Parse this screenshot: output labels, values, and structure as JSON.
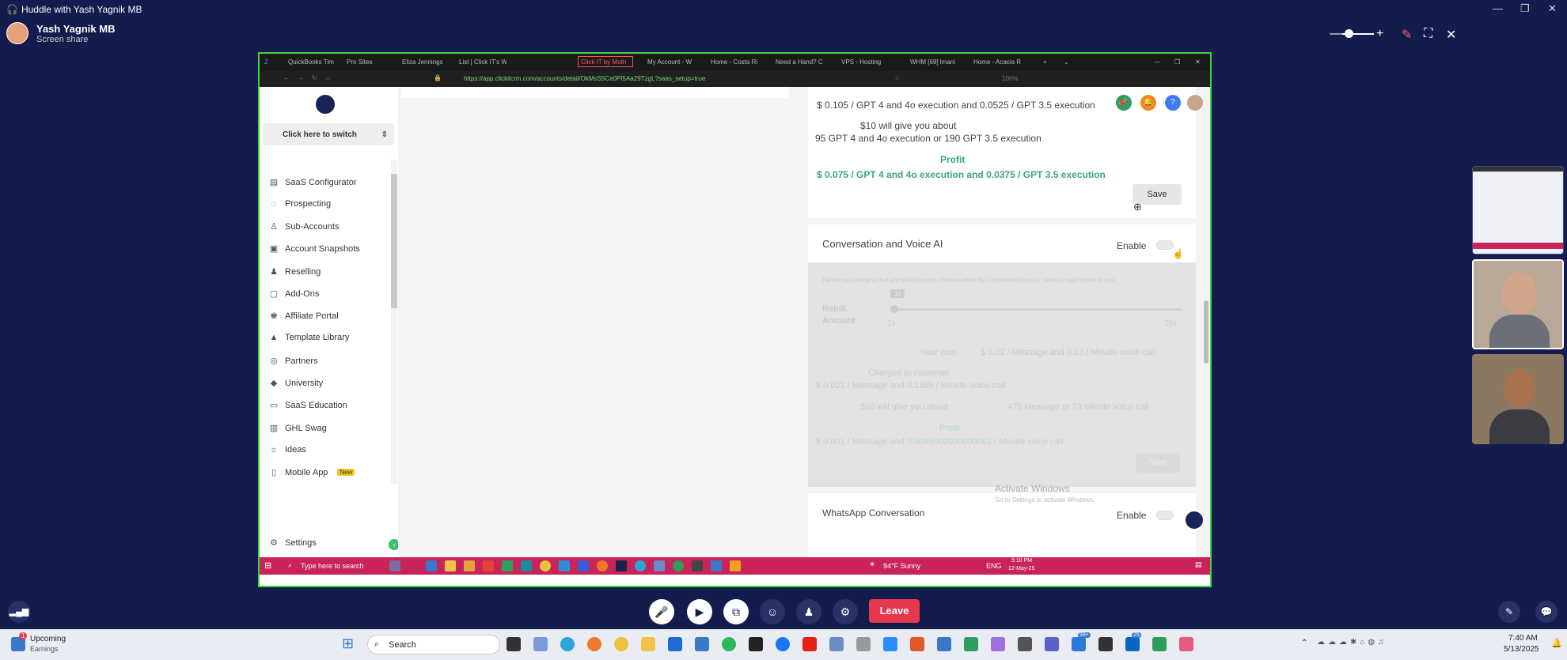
{
  "window": {
    "title": "Huddle with Yash Yagnik MB"
  },
  "presenter": {
    "name": "Yash Yagnik MB",
    "status": "Screen share"
  },
  "browser": {
    "tabs": [
      {
        "label": "QuickBooks Tim"
      },
      {
        "label": "Pro Sites"
      },
      {
        "label": "Eliza Jennings"
      },
      {
        "label": "List | Click IT's W"
      },
      {
        "label": "Click IT by Moth"
      },
      {
        "label": "My Account - W"
      },
      {
        "label": "Home - Costa Ri"
      },
      {
        "label": "Need a Hand? C"
      },
      {
        "label": "VPS - Hosting"
      },
      {
        "label": "WHM [69] lmani"
      },
      {
        "label": "Home - Acacia R"
      }
    ],
    "url": "https://app.clickitcrm.com/accounts/detail/OkMsS5Ce0PI5Aa29TzgL?saas_setup=true",
    "zoom": "100%"
  },
  "sidebar": {
    "switch_label": "Click here to switch",
    "items": [
      {
        "label": "SaaS Configurator",
        "icon": "chart-icon"
      },
      {
        "label": "Prospecting",
        "icon": "user-icon"
      },
      {
        "label": "Sub-Accounts",
        "icon": "user-icon"
      },
      {
        "label": "Account Snapshots",
        "icon": "image-icon"
      },
      {
        "label": "Reselling",
        "icon": "person-icon"
      },
      {
        "label": "Add-Ons",
        "icon": "bag-icon"
      },
      {
        "label": "Affiliate Portal",
        "icon": "users-icon"
      },
      {
        "label": "Template Library",
        "icon": "shapes-icon"
      },
      {
        "label": "Partners",
        "icon": "handshake-icon"
      },
      {
        "label": "University",
        "icon": "graduation-icon"
      },
      {
        "label": "SaaS Education",
        "icon": "book-icon"
      },
      {
        "label": "GHL Swag",
        "icon": "shop-icon"
      },
      {
        "label": "Ideas",
        "icon": "bulb-icon"
      },
      {
        "label": "Mobile App",
        "icon": "phone-icon",
        "badge": "New"
      }
    ],
    "settings_label": "Settings"
  },
  "gpt_section": {
    "price_line": "$ 0.105 / GPT 4 and 4o execution and 0.0525 / GPT 3.5 execution",
    "give_about": "$10 will give you about",
    "give_value": "95 GPT 4 and 4o execution or 190 GPT 3.5 execution",
    "profit_label": "Profit",
    "profit_value": "$ 0.075 / GPT 4 and 4o execution and 0.0375 / GPT 3.5 execution",
    "save_label": "Save"
  },
  "voice_section": {
    "title": "Conversation and Voice AI",
    "enable_label": "Enable",
    "intro": "Please set margins that are billed to your. Please enter the Conversation cost. Value to rate below to you",
    "rebill_label": "Rebill Amount",
    "slider_badge": "1x",
    "slider_min": "1x",
    "slider_max": "10x",
    "your_cost_label": "Your cost",
    "your_cost_value": "$ 0.02 / Message and 0.13 / Minute voice call",
    "charged_label": "Charged to customer",
    "charged_value": "$ 0.021 / Message and 0.1365 / Minute voice call",
    "give_about": "$10 will give you about",
    "give_value": "475 Message or 73 Minute voice call",
    "profit_label": "Profit",
    "profit_value": "$ 0.001 / Message and 0.0065000000000001 / Minute voice call",
    "save_label": "Save"
  },
  "whatsapp_section": {
    "title": "WhatsApp Conversation",
    "enable_label": "Enable"
  },
  "watermark": {
    "title": "Activate Windows",
    "sub": "Go to Settings to activate Windows."
  },
  "remote_taskbar": {
    "search_placeholder": "Type here to search",
    "weather": "94°F  Sunny",
    "lang": "ENG",
    "time": "5:10 PM",
    "date": "12-May-25"
  },
  "huddle_controls": {
    "leave_label": "Leave"
  },
  "windows_taskbar": {
    "widget_title": "Upcoming",
    "widget_sub": "Earnings",
    "widget_badge": "1",
    "search_label": "Search",
    "time": "7:40 AM",
    "date": "5/13/2025",
    "badges": [
      "1",
      "99+",
      "25"
    ]
  }
}
